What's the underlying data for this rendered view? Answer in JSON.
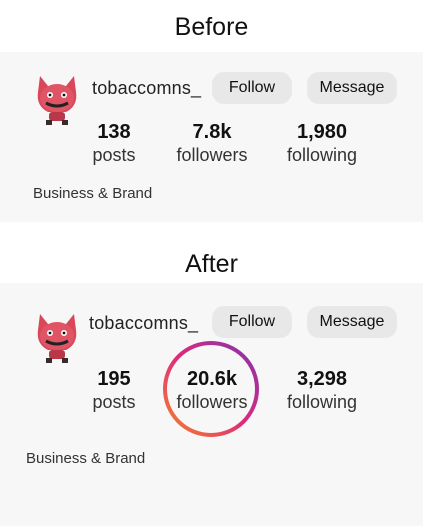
{
  "before": {
    "title": "Before",
    "username": "tobaccomns_",
    "follow_label": "Follow",
    "message_label": "Message",
    "stats": [
      {
        "value": "138",
        "label": "posts"
      },
      {
        "value": "7.8k",
        "label": "followers"
      },
      {
        "value": "1,980",
        "label": "following"
      }
    ],
    "category": "Business & Brand"
  },
  "after": {
    "title": "After",
    "username": "tobaccomns_",
    "follow_label": "Follow",
    "message_label": "Message",
    "stats": [
      {
        "value": "195",
        "label": "posts"
      },
      {
        "value": "20.6k",
        "label": "followers"
      },
      {
        "value": "3,298",
        "label": "following"
      }
    ],
    "category": "Business & Brand"
  },
  "colors": {
    "ring_gradient": [
      "#f58529",
      "#dd2a7b",
      "#8134af"
    ],
    "avatar": "#d9485a"
  }
}
